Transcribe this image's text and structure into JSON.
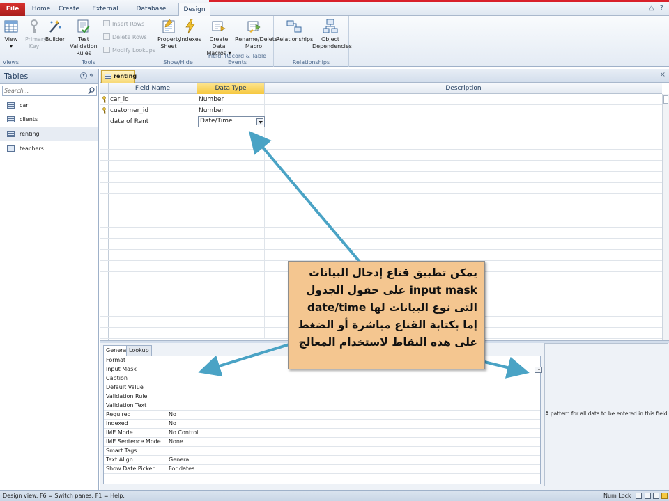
{
  "ribbon": {
    "tabs": [
      "File",
      "Home",
      "Create",
      "External Data",
      "Database Tools",
      "Design"
    ],
    "active_tab": "Design",
    "groups": {
      "views": {
        "label": "Views",
        "view": "View"
      },
      "tools": {
        "label": "Tools",
        "primary_key": [
          "Primary",
          "Key"
        ],
        "builder": "Builder",
        "test_validation": [
          "Test Validation",
          "Rules"
        ],
        "insert_rows": "Insert Rows",
        "delete_rows": "Delete Rows",
        "modify_lookups": "Modify Lookups"
      },
      "show_hide": {
        "label": "Show/Hide",
        "property_sheet": [
          "Property",
          "Sheet"
        ],
        "indexes": "Indexes"
      },
      "events": {
        "label": "Field, Record & Table Events",
        "create_data_macros": [
          "Create Data",
          "Macros ▾"
        ],
        "rename_delete_macro": [
          "Rename/Delete",
          "Macro"
        ]
      },
      "relationships": {
        "label": "Relationships",
        "relationships": "Relationships",
        "object_dependencies": [
          "Object",
          "Dependencies"
        ]
      }
    }
  },
  "nav": {
    "title": "Tables",
    "collapse_glyph": "«",
    "dropdown_glyph": "▾",
    "search_placeholder": "Search...",
    "items": [
      "car",
      "clients",
      "renting",
      "teachers"
    ],
    "selected": "renting"
  },
  "document": {
    "tab_label": "renting",
    "close_glyph": "×"
  },
  "grid": {
    "headers": [
      "Field Name",
      "Data Type",
      "Description"
    ],
    "rows": [
      {
        "field": "car_id",
        "type": "Number",
        "key": true
      },
      {
        "field": "customer_id",
        "type": "Number",
        "key": true
      },
      {
        "field": "date of Rent",
        "type": "Date/Time",
        "key": false
      }
    ]
  },
  "properties": {
    "tabs": [
      "General",
      "Lookup"
    ],
    "active_tab": "General",
    "rows": [
      {
        "label": "Format",
        "value": ""
      },
      {
        "label": "Input Mask",
        "value": ""
      },
      {
        "label": "Caption",
        "value": ""
      },
      {
        "label": "Default Value",
        "value": ""
      },
      {
        "label": "Validation Rule",
        "value": ""
      },
      {
        "label": "Validation Text",
        "value": ""
      },
      {
        "label": "Required",
        "value": "No"
      },
      {
        "label": "Indexed",
        "value": "No"
      },
      {
        "label": "IME Mode",
        "value": "No Control"
      },
      {
        "label": "IME Sentence Mode",
        "value": "None"
      },
      {
        "label": "Smart Tags",
        "value": ""
      },
      {
        "label": "Text Align",
        "value": "General"
      },
      {
        "label": "Show Date Picker",
        "value": "For dates"
      }
    ],
    "builder_glyph": "...",
    "hint": "A pattern for all data to be entered in this field"
  },
  "status": {
    "left": "Design view.  F6 = Switch panes.  F1 = Help.",
    "right": "Num Lock"
  },
  "callout": {
    "lines": [
      "يمكن تطبيق قناع إدخال البيانات",
      "input mask على حقول الجدول",
      "التى نوع البيانات لها date/time",
      "إما بكتابة القناع مباشرة أو الضغط",
      "على هذه النقاط لاستخدام المعالج"
    ]
  },
  "colors": {
    "accent_file": "#c62828",
    "active_header": "#f6c840",
    "callout_bg": "#f4c690",
    "arrow": "#4aa3c5"
  }
}
